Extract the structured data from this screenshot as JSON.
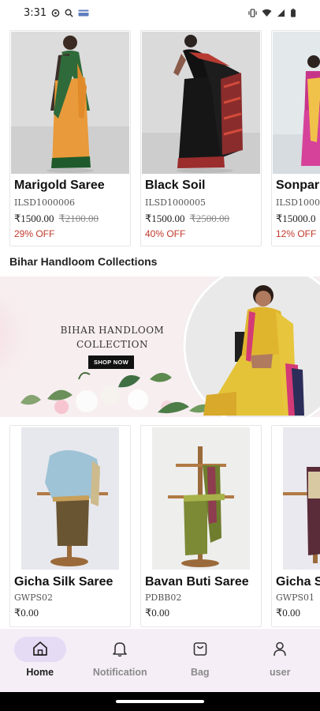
{
  "status_bar": {
    "time": "3:31",
    "left_icons": [
      "settings-icon",
      "search-icon",
      "card-icon"
    ],
    "right_icons": [
      "vibrate-icon",
      "wifi-icon",
      "signal-icon",
      "battery-icon"
    ]
  },
  "featured_products": [
    {
      "name": "Marigold Saree",
      "sku": "ILSD1000006",
      "price": "₹1500.00",
      "mrp": "₹2100.00",
      "discount": "29% OFF"
    },
    {
      "name": "Black Soil",
      "sku": "ILSD1000005",
      "price": "₹1500.00",
      "mrp": "₹2500.00",
      "discount": "40% OFF"
    },
    {
      "name": "Sonpar",
      "sku": "ILSD1000",
      "price": "₹15000.0",
      "mrp": "",
      "discount": "12% OFF"
    }
  ],
  "section": {
    "title": "Bihar Handloom Collections"
  },
  "banner": {
    "line1": "BIHAR HANDLOOM",
    "line2": "COLLECTION",
    "button_label": "SHOP NOW"
  },
  "collection_products": [
    {
      "name": "Gicha Silk Saree",
      "sku": "GWPS02",
      "price": "₹0.00"
    },
    {
      "name": "Bavan Buti Saree",
      "sku": "PDBB02",
      "price": "₹0.00"
    },
    {
      "name": "Gicha Si",
      "sku": "GWPS01",
      "price": "₹0.00"
    }
  ],
  "bottom_nav": [
    {
      "label": "Home",
      "icon": "home-icon",
      "active": true
    },
    {
      "label": "Notification",
      "icon": "bell-icon",
      "active": false
    },
    {
      "label": "Bag",
      "icon": "bag-icon",
      "active": false
    },
    {
      "label": "user",
      "icon": "user-icon",
      "active": false
    }
  ],
  "colors": {
    "discount": "#c0392b",
    "nav_background": "#f5eef7",
    "nav_active_pill": "#e6dbf5",
    "banner_button": "#111111"
  }
}
